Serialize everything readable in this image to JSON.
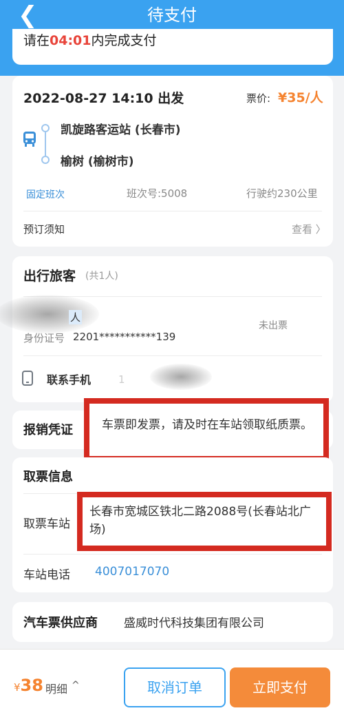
{
  "header": {
    "title": "待支付",
    "back_icon": "chevron-left-icon"
  },
  "timer": {
    "prefix": "请在",
    "countdown": "04:01",
    "suffix": "内完成支付"
  },
  "trip": {
    "departure": "2022-08-27 14:10 出发",
    "price_label": "票价:",
    "price": "¥35/人",
    "origin": "凯旋路客运站 (长春市)",
    "destination": "榆树 (榆树市)",
    "type_tag": "固定班次",
    "trip_number": "班次号:5008",
    "distance": "行驶约230公里",
    "notice_label": "预订须知",
    "view_label": "查看 〉"
  },
  "passengers": {
    "title": "出行旅客",
    "count": "(共1人)",
    "name_suffix": "人",
    "status": "未出票",
    "id_label": "身份证号",
    "id_value": "2201***********139",
    "phone_label": "联系手机",
    "phone_value": "1"
  },
  "receipt": {
    "title": "报销凭证",
    "text": "车票即发票，请及时在车站领取纸质票。"
  },
  "ticket_info": {
    "title": "取票信息",
    "station_label": "取票车站",
    "station_address": "长春市宽城区铁北二路2088号(长春站北广场)",
    "phone_label": "车站电话",
    "phone_value": "4007017070"
  },
  "supplier": {
    "title": "汽车票供应商",
    "name": "盛威时代科技集团有限公司"
  },
  "footer": {
    "currency": "¥",
    "total": "38",
    "detail_label": "明细",
    "detail_arrow": "^",
    "cancel_label": "取消订单",
    "pay_label": "立即支付"
  },
  "colors": {
    "primary": "#3aa2f0",
    "accent": "#f5832f",
    "highlight": "#d42a20"
  }
}
